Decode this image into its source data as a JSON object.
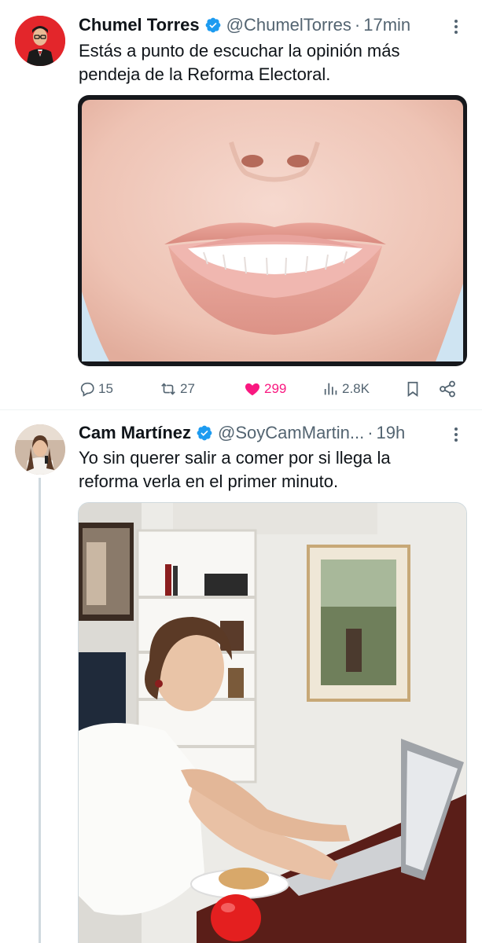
{
  "tweets": [
    {
      "name": "Chumel Torres",
      "handle": "@ChumelTorres",
      "separator": "·",
      "time": "17min",
      "text_line1": "Estás a punto de escuchar la opinión más",
      "text_line2": "pendeja de la Reforma Electoral.",
      "media_icon": "smiling-mouth-image",
      "stats": {
        "replies": "15",
        "reposts": "27",
        "likes": "299",
        "views": "2.8K"
      }
    },
    {
      "name": "Cam Martínez",
      "handle": "@SoyCamMartin...",
      "separator": "·",
      "time": "19h",
      "text_line1": "Yo sin querer salir a comer por si llega la",
      "text_line2": "reforma verla en el primer minuto.",
      "media_icon": "woman-at-laptop-office-photo"
    }
  ],
  "colors": {
    "verified": "#1d9bf0",
    "like": "#f91880",
    "muted": "#536471",
    "text": "#0f1419"
  },
  "icons": [
    "reply-icon",
    "repost-icon",
    "heart-icon",
    "views-icon",
    "bookmark-icon",
    "share-icon",
    "verified-badge-icon",
    "more-options-icon"
  ]
}
